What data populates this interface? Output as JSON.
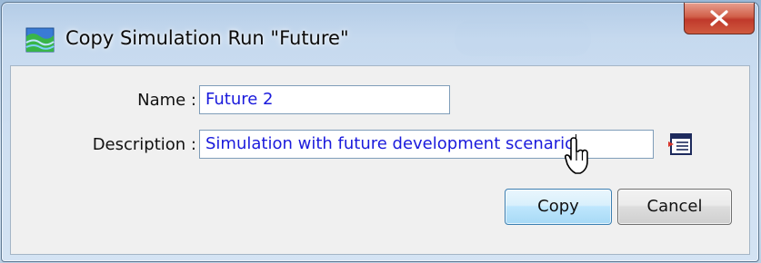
{
  "window": {
    "title": "Copy Simulation Run \"Future\"",
    "close_symbol": "X",
    "icon": "simulation-run-icon"
  },
  "form": {
    "name_label": "Name :",
    "name_value": "Future 2",
    "description_label": "Description :",
    "description_value": "Simulation with future development scenario",
    "description_editor_icon": "text-editor-icon"
  },
  "buttons": {
    "copy_label": "Copy",
    "cancel_label": "Cancel"
  },
  "colors": {
    "field_text": "#1a1adc",
    "close_button": "#c0392b",
    "default_button_border": "#3c7fb1"
  }
}
